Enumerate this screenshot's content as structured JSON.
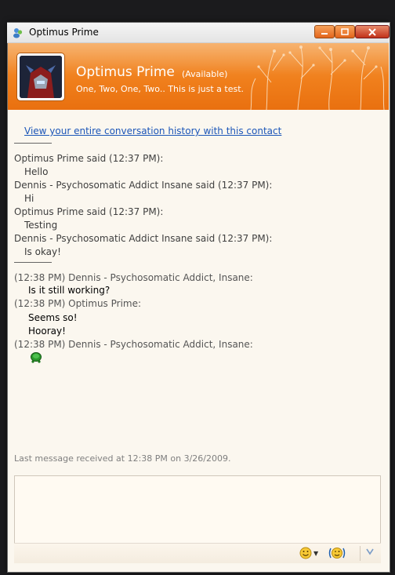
{
  "window": {
    "title": "Optimus Prime"
  },
  "contact": {
    "name": "Optimus Prime",
    "status": "(Available)",
    "personal_message": "One, Two, One, Two.. This is just a test."
  },
  "history_link": "View your entire conversation history with this contact",
  "old_messages": [
    {
      "header": "Optimus Prime said (12:37 PM):",
      "text": "Hello"
    },
    {
      "header": "Dennis - Psychosomatic Addict Insane said (12:37 PM):",
      "text": "Hi"
    },
    {
      "header": "Optimus Prime said (12:37 PM):",
      "text": "Testing"
    },
    {
      "header": "Dennis - Psychosomatic Addict Insane said (12:37 PM):",
      "text": "Is okay!"
    }
  ],
  "new_messages": [
    {
      "header": "(12:38 PM) Dennis - Psychosomatic Addict, Insane:",
      "lines": [
        "Is it still working?"
      ]
    },
    {
      "header": "(12:38 PM) Optimus Prime:",
      "lines": [
        "Seems so!",
        "Hooray!"
      ]
    },
    {
      "header": "(12:38 PM) Dennis - Psychosomatic Addict, Insane:",
      "lines": [],
      "emoticon": "turtle-emoticon"
    }
  ],
  "last_message_info": "Last message received at 12:38 PM on 3/26/2009.",
  "colors": {
    "header_orange": "#f07f1c",
    "link_blue": "#1c56b8"
  },
  "toolbar": {
    "emoticon_icon": "smiley-icon",
    "wink_icon": "wink-icon",
    "more_icon": "chevron-down-icon"
  }
}
